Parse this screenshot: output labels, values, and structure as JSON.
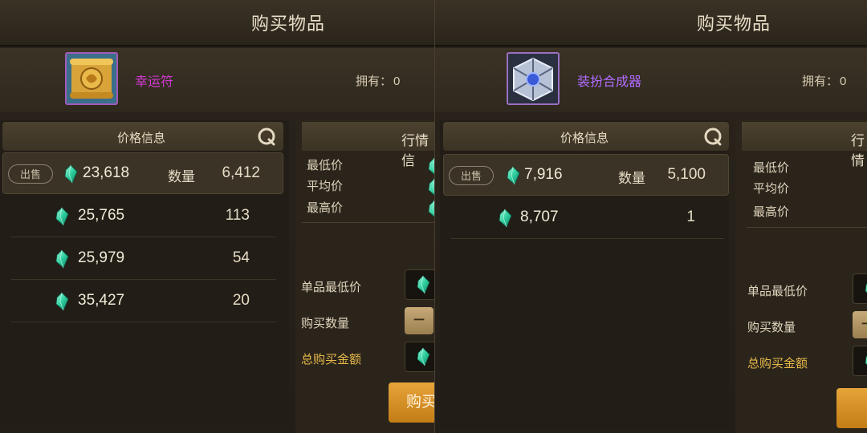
{
  "colors": {
    "item_name_left": "#d338d3",
    "item_name_right": "#b16bff",
    "gold_label": "#e8b94a",
    "buy_button": "#d89028",
    "gem": "#3fd0a6"
  },
  "left": {
    "title": "购买物品",
    "item_name": "幸运符",
    "owned_label": "拥有：",
    "owned_value": "0",
    "price_header": "价格信息",
    "market_header": "行情信",
    "market_rows": [
      "最低价",
      "平均价",
      "最高价"
    ],
    "listings": [
      {
        "tag": "出售",
        "price": "23,618",
        "qty_label": "数量",
        "qty": "6,412"
      },
      {
        "price": "25,765",
        "qty": "113"
      },
      {
        "price": "25,979",
        "qty": "54"
      },
      {
        "price": "35,427",
        "qty": "20"
      }
    ],
    "form": {
      "unit_min": "单品最低价",
      "buy_qty": "购买数量",
      "total": "总购买金额",
      "minus": "−",
      "buy": "购买"
    }
  },
  "right": {
    "title": "购买物品",
    "item_name": "装扮合成器",
    "owned_label": "拥有：",
    "owned_value": "0",
    "price_header": "价格信息",
    "market_header": "行情",
    "market_rows": [
      "最低价",
      "平均价",
      "最高价"
    ],
    "listings": [
      {
        "tag": "出售",
        "price": "7,916",
        "qty_label": "数量",
        "qty": "5,100"
      },
      {
        "price": "8,707",
        "qty": "1"
      }
    ],
    "form": {
      "unit_min": "单品最低价",
      "buy_qty": "购买数量",
      "total": "总购买金额",
      "minus": "−",
      "buy": ""
    }
  },
  "icons": {
    "gem": "gem-currency-icon",
    "refresh": "refresh-icon",
    "scroll": "lucky-charm-scroll-icon",
    "cube": "outfit-synthesizer-cube-icon"
  }
}
